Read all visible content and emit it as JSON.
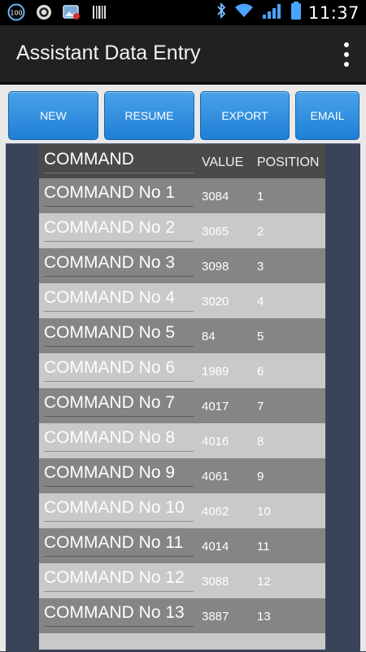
{
  "status_bar": {
    "time": "11:37",
    "notification_badge": "100",
    "icons": [
      "100-badge-icon",
      "circle-app-icon",
      "photo-alert-icon",
      "barcode-icon",
      "bluetooth-icon",
      "wifi-icon",
      "signal-icon",
      "battery-icon"
    ]
  },
  "app": {
    "title": "Assistant Data Entry"
  },
  "toolbar": {
    "buttons": [
      "NEW",
      "RESUME",
      "EXPORT",
      "EMAIL"
    ]
  },
  "table": {
    "headers": {
      "command": "COMMAND",
      "value": "VALUE",
      "position": "POSITION"
    },
    "rows": [
      {
        "command": "COMMAND No 1",
        "value": "3084",
        "position": "1"
      },
      {
        "command": "COMMAND No 2",
        "value": "3065",
        "position": "2"
      },
      {
        "command": "COMMAND No 3",
        "value": "3098",
        "position": "3"
      },
      {
        "command": "COMMAND No 4",
        "value": "3020",
        "position": "4"
      },
      {
        "command": "COMMAND No 5",
        "value": "84",
        "position": "5"
      },
      {
        "command": "COMMAND No 6",
        "value": "1989",
        "position": "6"
      },
      {
        "command": "COMMAND No 7",
        "value": "4017",
        "position": "7"
      },
      {
        "command": "COMMAND No 8",
        "value": "4016",
        "position": "8"
      },
      {
        "command": "COMMAND No 9",
        "value": "4061",
        "position": "9"
      },
      {
        "command": "COMMAND No 10",
        "value": "4062",
        "position": "10"
      },
      {
        "command": "COMMAND No 11",
        "value": "4014",
        "position": "11"
      },
      {
        "command": "COMMAND No 12",
        "value": "3088",
        "position": "12"
      },
      {
        "command": "COMMAND No 13",
        "value": "3887",
        "position": "13"
      }
    ]
  },
  "colors": {
    "accent_button": "#1f7fd6",
    "row_dark": "#858585",
    "row_light": "#c9c9c9",
    "panel_bg": "#3a4459"
  }
}
